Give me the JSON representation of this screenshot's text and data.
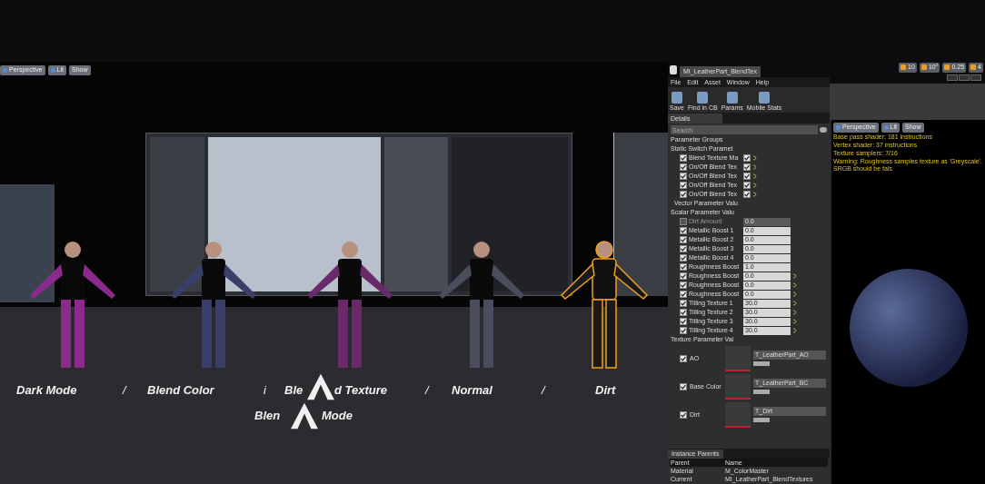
{
  "viewport": {
    "toolbar": [
      "Perspective",
      "Lit",
      "Show"
    ],
    "floor_labels": [
      {
        "text": "Dark Mode",
        "kind": "label"
      },
      {
        "text": "/",
        "kind": "sep"
      },
      {
        "text": "Blend Color",
        "kind": "label"
      },
      {
        "text": "i",
        "kind": "sep"
      },
      {
        "text": "Ble",
        "kind": "label"
      },
      {
        "text": "d Texture",
        "kind": "label"
      },
      {
        "text": "/",
        "kind": "sep"
      },
      {
        "text": "Normal",
        "kind": "label"
      },
      {
        "text": "/",
        "kind": "sep"
      },
      {
        "text": "Dirt",
        "kind": "label"
      }
    ],
    "floor_labels_line2": [
      "Blen",
      "Mode"
    ],
    "characters": [
      {
        "selected": false,
        "color": "#8a2a8a"
      },
      {
        "selected": false,
        "color": "#3a3f6a"
      },
      {
        "selected": false,
        "color": "#6a2a6a"
      },
      {
        "selected": false,
        "color": "#4a4e5c"
      },
      {
        "selected": true,
        "color": "#1a1a1a"
      }
    ]
  },
  "top_toolbar": [
    "10",
    "10°",
    "0.25",
    "4"
  ],
  "editor": {
    "tab_title": "MI_LeatherPart_BlendTex",
    "menu": [
      "File",
      "Edit",
      "Asset",
      "Window",
      "Help"
    ],
    "tools": [
      "Save",
      "Find in CB",
      "Params",
      "Mobile Stats"
    ],
    "details_tab": "Details",
    "search": {
      "placeholder": "Search"
    },
    "groups_title": "Parameter Groups",
    "static_title": "Static Switch Paramet",
    "static_switches": [
      {
        "label": "Blend Texture Ma",
        "checked": true,
        "value": true
      },
      {
        "label": "On/Off Blend Tex",
        "checked": true,
        "value": true
      },
      {
        "label": "On/Off Blend Tex",
        "checked": true,
        "value": true
      },
      {
        "label": "On/Off Blend Tex",
        "checked": true,
        "value": true
      },
      {
        "label": "On/Off Blend Tex",
        "checked": true,
        "value": true
      }
    ],
    "vector_title": "Vector Parameter Valu",
    "scalar_title": "Scalar Parameter Valu",
    "scalars": [
      {
        "label": "Dirt Amount",
        "checked": false,
        "value": "0.0",
        "reset": false
      },
      {
        "label": "Metallic Boost 1",
        "checked": true,
        "value": "0.0",
        "reset": false
      },
      {
        "label": "Metallic Boost 2",
        "checked": true,
        "value": "0.0",
        "reset": false
      },
      {
        "label": "Metallic Boost 3",
        "checked": true,
        "value": "0.0",
        "reset": false
      },
      {
        "label": "Metallic Boost 4",
        "checked": true,
        "value": "0.0",
        "reset": false
      },
      {
        "label": "Roughness Boost",
        "checked": true,
        "value": "1.0",
        "reset": false
      },
      {
        "label": "Roughness Boost",
        "checked": true,
        "value": "0.0",
        "reset": true
      },
      {
        "label": "Roughness Boost",
        "checked": true,
        "value": "0.0",
        "reset": true
      },
      {
        "label": "Roughness Boost",
        "checked": true,
        "value": "0.0",
        "reset": true
      },
      {
        "label": "Tilling Texture 1",
        "checked": true,
        "value": "30.0",
        "reset": true
      },
      {
        "label": "Tilling Texture 2",
        "checked": true,
        "value": "30.0",
        "reset": true
      },
      {
        "label": "Tilling Texture 3",
        "checked": true,
        "value": "30.0",
        "reset": true
      },
      {
        "label": "Tilling Texture 4",
        "checked": true,
        "value": "30.0",
        "reset": true
      }
    ],
    "texture_title": "Texture Parameter Val",
    "textures": [
      {
        "label": "AO",
        "checked": true,
        "asset": "T_LeatherPart_AO"
      },
      {
        "label": "Base Color",
        "checked": true,
        "asset": "T_LeatherPart_BC"
      },
      {
        "label": "Dirt",
        "checked": true,
        "asset": "T_Dirt"
      }
    ],
    "parents_tab": "Instance Parents",
    "parents_columns": [
      "Parent",
      "Name"
    ],
    "parents_rows": [
      [
        "Material",
        "M_ColorMaster"
      ],
      [
        "Current",
        "MI_LeatherPart_BlendTextures"
      ]
    ]
  },
  "preview": {
    "toolbar": [
      "Perspective",
      "Lit",
      "Show"
    ],
    "stats": [
      "Base pass shader: 181 instructions",
      "Vertex shader: 37 instructions",
      "Texture samplers: 7/16",
      "Warning: Roughness samples texture as 'Greyscale'. SRGB should be fals"
    ]
  }
}
